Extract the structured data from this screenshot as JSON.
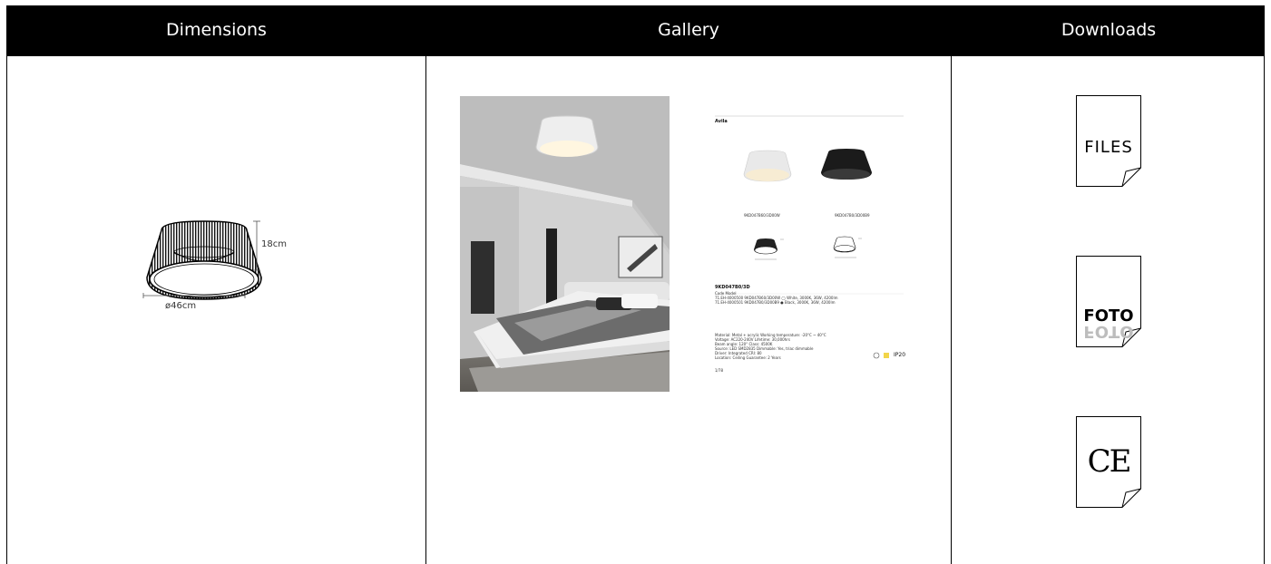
{
  "headers": {
    "dimensions": "Dimensions",
    "gallery": "Gallery",
    "downloads": "Downloads"
  },
  "dimensions": {
    "height": "18cm",
    "diameter": "ø46cm"
  },
  "datasheet": {
    "title": "Avila",
    "models": [
      "9KD047B60/3D00W",
      "9KD047B0/3D00B9"
    ],
    "code_title": "9KD047B0/3D",
    "rows": [
      "Code                 Model                                              ",
      "71.EH-4000500    9KD047B60/3D00W     ◯ White, 3000K, 36W, 4200lm",
      "71.EH-4000501    9KD047B0/3D00B9     ● Black, 3000K, 36W, 4200lm"
    ],
    "details": [
      "Material: Metal + acrylic          Working temperature: -20°C ~ 40°C",
      "Voltage: AC220-240V                 Lifetime: 30,000hrs",
      "Beam angle: 120°                    Class: 4500K",
      "Source: LED SMD2835                 Dimmable: Yes, triac dimmable",
      "Driver: Integrated                  CRI: 80",
      "Location: Ceiling                   Guarantee: 2 Years"
    ],
    "ip": "IP20",
    "page": "1/78"
  },
  "downloads": {
    "files": "FILES",
    "foto": "FOTO",
    "ce": "CE"
  },
  "colors": {
    "header_bg": "#000000",
    "header_text": "#ffffff",
    "border": "#000000"
  }
}
